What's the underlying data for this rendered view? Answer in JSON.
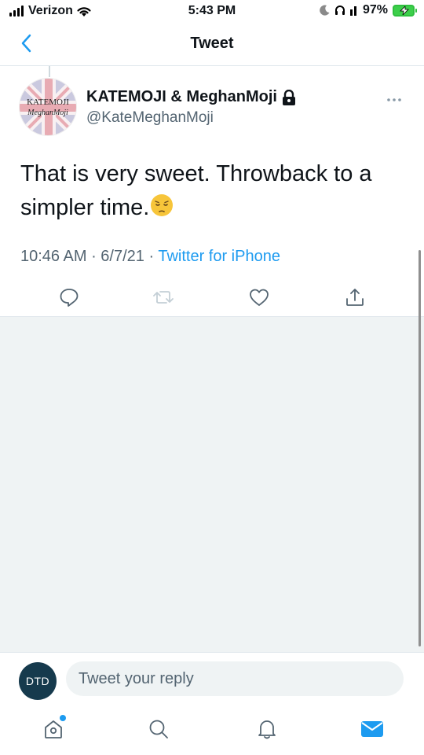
{
  "status_bar": {
    "carrier": "Verizon",
    "time": "5:43 PM",
    "battery": "97%"
  },
  "header": {
    "title": "Tweet"
  },
  "tweet": {
    "avatar_line1": "KATEMOJI",
    "avatar_line2": "MeghanMoji",
    "display_name": "KATEMOJI & MeghanMoji",
    "handle": "@KateMeghanMoji",
    "text": "That is very sweet. Throwback to a simpler time.",
    "emoji": "pensive-face",
    "time": "10:46 AM",
    "date": "6/7/21",
    "source": "Twitter for iPhone"
  },
  "reply": {
    "avatar_initials": "DTD",
    "placeholder": "Tweet your reply"
  },
  "colors": {
    "accent": "#1d9bf0",
    "text_secondary": "#536471",
    "battery": "#3ccf4a"
  },
  "icons": {
    "actions": [
      "reply-icon",
      "retweet-icon",
      "like-icon",
      "share-icon"
    ],
    "tabs": [
      "home-icon",
      "search-icon",
      "notifications-icon",
      "messages-icon"
    ]
  }
}
